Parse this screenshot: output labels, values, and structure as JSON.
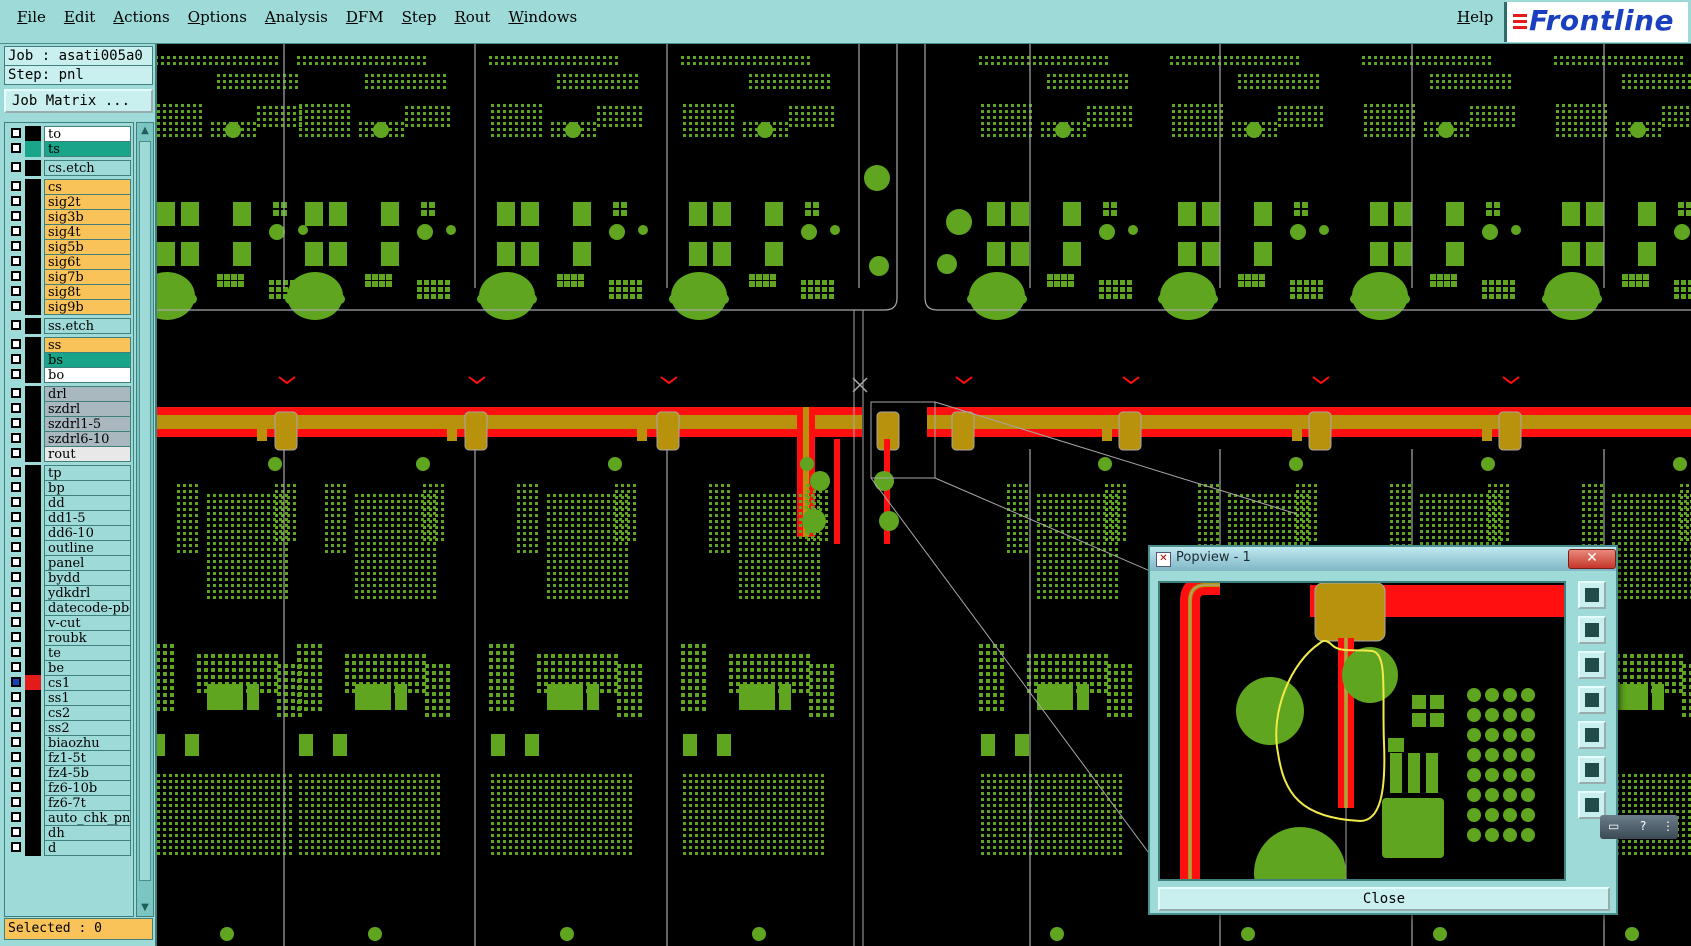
{
  "menubar": {
    "items": [
      "File",
      "Edit",
      "Actions",
      "Options",
      "Analysis",
      "DFM",
      "Step",
      "Rout",
      "Windows"
    ],
    "help": "Help",
    "logo": "Frontline"
  },
  "job": {
    "job_line": "Job : asati005a0",
    "step_line": "Step: pnl",
    "matrix_button": "Job Matrix ..."
  },
  "layers": [
    {
      "name": "to",
      "bg": "#ffffff",
      "swatch": "#000000"
    },
    {
      "name": "ts",
      "bg": "#1aa58a",
      "swatch": "#1aa58a"
    },
    {
      "name": "cs.etch",
      "bg": "#9edbd8",
      "swatch": "#000000",
      "gap": true
    },
    {
      "name": "cs",
      "bg": "#f9c35a",
      "swatch": "#000000",
      "gap": true
    },
    {
      "name": "sig2t",
      "bg": "#f9c35a",
      "swatch": "#000000"
    },
    {
      "name": "sig3b",
      "bg": "#f9c35a",
      "swatch": "#000000"
    },
    {
      "name": "sig4t",
      "bg": "#f9c35a",
      "swatch": "#000000"
    },
    {
      "name": "sig5b",
      "bg": "#f9c35a",
      "swatch": "#000000"
    },
    {
      "name": "sig6t",
      "bg": "#f9c35a",
      "swatch": "#000000"
    },
    {
      "name": "sig7b",
      "bg": "#f9c35a",
      "swatch": "#000000"
    },
    {
      "name": "sig8t",
      "bg": "#f9c35a",
      "swatch": "#000000"
    },
    {
      "name": "sig9b",
      "bg": "#f9c35a",
      "swatch": "#000000"
    },
    {
      "name": "ss.etch",
      "bg": "#9edbd8",
      "swatch": "#000000",
      "gap": true
    },
    {
      "name": "ss",
      "bg": "#f9c35a",
      "swatch": "#000000",
      "gap": true
    },
    {
      "name": "bs",
      "bg": "#1aa58a",
      "swatch": "#000000"
    },
    {
      "name": "bo",
      "bg": "#ffffff",
      "swatch": "#000000"
    },
    {
      "name": "drl",
      "bg": "#a9b8be",
      "swatch": "#000000",
      "gap": true
    },
    {
      "name": "szdrl",
      "bg": "#a9b8be",
      "swatch": "#000000"
    },
    {
      "name": "szdrl1-5",
      "bg": "#a9b8be",
      "swatch": "#000000"
    },
    {
      "name": "szdrl6-10",
      "bg": "#a9b8be",
      "swatch": "#000000"
    },
    {
      "name": "rout",
      "bg": "#e8e8e8",
      "swatch": "#000000"
    },
    {
      "name": "tp",
      "bg": "#9edbd8",
      "swatch": "#000000",
      "gap": true
    },
    {
      "name": "bp",
      "bg": "#9edbd8",
      "swatch": "#000000"
    },
    {
      "name": "dd",
      "bg": "#9edbd8",
      "swatch": "#000000"
    },
    {
      "name": "dd1-5",
      "bg": "#9edbd8",
      "swatch": "#000000"
    },
    {
      "name": "dd6-10",
      "bg": "#9edbd8",
      "swatch": "#000000"
    },
    {
      "name": "outline",
      "bg": "#9edbd8",
      "swatch": "#000000"
    },
    {
      "name": "panel",
      "bg": "#9edbd8",
      "swatch": "#000000"
    },
    {
      "name": "bydd",
      "bg": "#9edbd8",
      "swatch": "#000000"
    },
    {
      "name": "ydkdrl",
      "bg": "#9edbd8",
      "swatch": "#000000"
    },
    {
      "name": "datecode-pbo",
      "bg": "#9edbd8",
      "swatch": "#000000"
    },
    {
      "name": "v-cut",
      "bg": "#9edbd8",
      "swatch": "#000000"
    },
    {
      "name": "roubk",
      "bg": "#9edbd8",
      "swatch": "#000000"
    },
    {
      "name": "te",
      "bg": "#9edbd8",
      "swatch": "#000000"
    },
    {
      "name": "be",
      "bg": "#9edbd8",
      "swatch": "#000000"
    },
    {
      "name": "cs1",
      "bg": "#9edbd8",
      "swatch": "#e41b1b",
      "checked": true
    },
    {
      "name": "ss1",
      "bg": "#9edbd8",
      "swatch": "#000000"
    },
    {
      "name": "cs2",
      "bg": "#9edbd8",
      "swatch": "#000000"
    },
    {
      "name": "ss2",
      "bg": "#9edbd8",
      "swatch": "#000000"
    },
    {
      "name": "biaozhu",
      "bg": "#9edbd8",
      "swatch": "#000000"
    },
    {
      "name": "fz1-5t",
      "bg": "#9edbd8",
      "swatch": "#000000"
    },
    {
      "name": "fz4-5b",
      "bg": "#9edbd8",
      "swatch": "#000000"
    },
    {
      "name": "fz6-10b",
      "bg": "#9edbd8",
      "swatch": "#000000"
    },
    {
      "name": "fz6-7t",
      "bg": "#9edbd8",
      "swatch": "#000000"
    },
    {
      "name": "auto_chk_pn",
      "bg": "#9edbd8",
      "swatch": "#000000"
    },
    {
      "name": "dh",
      "bg": "#9edbd8",
      "swatch": "#000000"
    },
    {
      "name": "d",
      "bg": "#9edbd8",
      "swatch": "#000000"
    }
  ],
  "status": {
    "selected": "Selected : 0"
  },
  "popview": {
    "title": "Popview - 1",
    "close_x": "✕",
    "close_button": "Close",
    "tools": [
      "zoom-fit-icon",
      "pan-up-icon",
      "pan-down-icon",
      "pan-left-icon",
      "pan-right-icon",
      "zoom-in-icon",
      "zoom-out-icon"
    ]
  },
  "colors": {
    "copper": "#5fa51f",
    "trace": "#ff0f0f",
    "pad": "#b8920c",
    "outline": "#a8a8a8",
    "highlight": "#f2ea4a"
  }
}
